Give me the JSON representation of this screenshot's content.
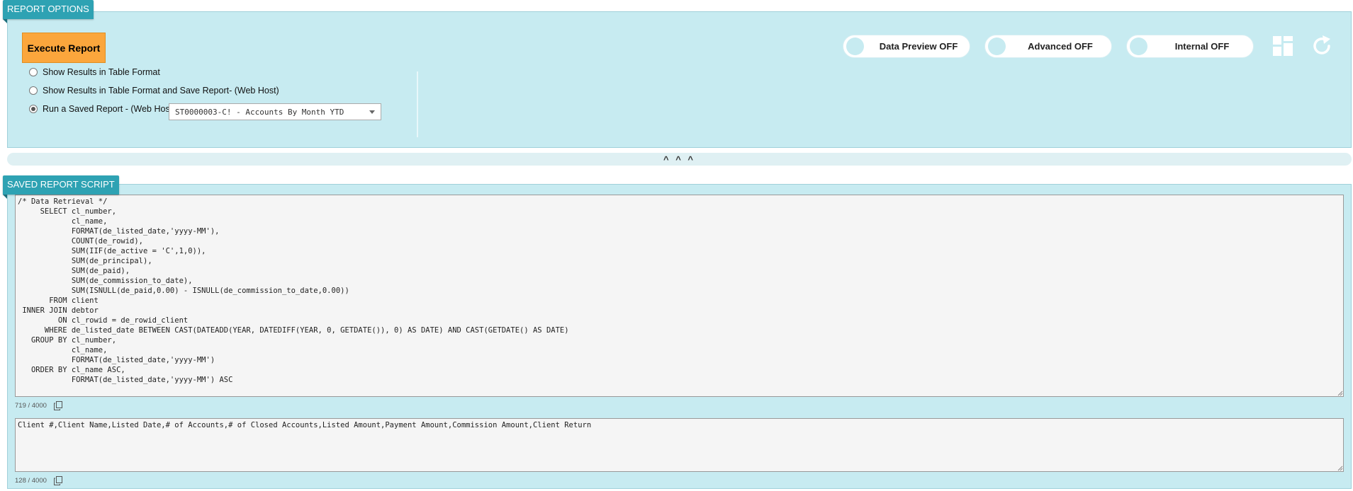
{
  "options_panel": {
    "tab_label": "REPORT OPTIONS",
    "execute_label": "Execute Report",
    "radios": [
      {
        "label": "Show Results in Table Format",
        "checked": false
      },
      {
        "label": "Show Results in Table Format and Save Report- (Web Host)",
        "checked": false
      },
      {
        "label": "Run a Saved Report - (Web Host)",
        "checked": true
      }
    ],
    "saved_report_select": {
      "value": "ST0000003-C! - Accounts By Month YTD"
    },
    "toggles": [
      {
        "label": "Data Preview OFF",
        "state": "off"
      },
      {
        "label": "Advanced OFF",
        "state": "off"
      },
      {
        "label": "Internal OFF",
        "state": "off"
      }
    ],
    "icons": [
      "layout-grid-icon",
      "refresh-icon"
    ]
  },
  "collapse_label": "^ ^ ^",
  "script_panel": {
    "tab_label": "SAVED REPORT SCRIPT",
    "sql_text": "/* Data Retrieval */\n     SELECT cl_number,\n            cl_name,\n            FORMAT(de_listed_date,'yyyy-MM'),\n            COUNT(de_rowid),\n            SUM(IIF(de_active = 'C',1,0)),\n            SUM(de_principal),\n            SUM(de_paid),\n            SUM(de_commission_to_date),\n            SUM(ISNULL(de_paid,0.00) - ISNULL(de_commission_to_date,0.00))\n       FROM client\n INNER JOIN debtor\n         ON cl_rowid = de_rowid_client\n      WHERE de_listed_date BETWEEN CAST(DATEADD(YEAR, DATEDIFF(YEAR, 0, GETDATE()), 0) AS DATE) AND CAST(GETDATE() AS DATE)\n   GROUP BY cl_number,\n            cl_name,\n            FORMAT(de_listed_date,'yyyy-MM')\n   ORDER BY cl_name ASC,\n            FORMAT(de_listed_date,'yyyy-MM') ASC",
    "sql_counter": "719 / 4000",
    "columns_text": "Client #,Client Name,Listed Date,# of Accounts,# of Closed Accounts,Listed Amount,Payment Amount,Commission Amount,Client Return",
    "columns_counter": "128 / 4000"
  },
  "colors": {
    "panel_bg": "#c7ebf1",
    "tab_bg": "#2ea2b3",
    "execute_bg": "#fba63c"
  }
}
